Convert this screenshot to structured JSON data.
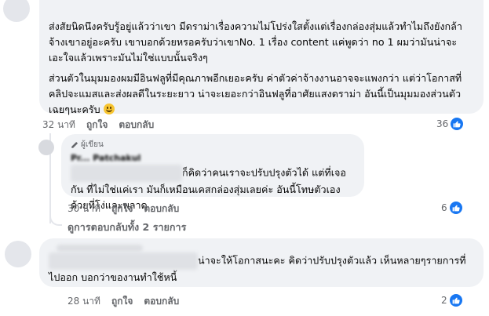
{
  "comment1": {
    "paragraphs": [
      "ส่งสัยนิดนึงครับรู้อยู่แล้วว่าเขา มีดราม่าเรื่องความไม่โปร่งใสตั้งแต่เรื่องกล่องสุ่มแล้วทำไมถึงยังกล้าจ้างเขาอยู่อะครับ เขาบอกด้วยหรอครับว่าเขาNo. 1 เรื่อง content แค่พูดว่า no 1 ผมว่ามันน่าจะเอะใจแล้วเพราะมันไม่ใช่แบบนั้นจริงๆ",
      "ส่วนตัวในมุมมองผมมีอินฟลูที่มีคุณภาพอีกเยอะครับ ค่าตัวค่าจ้างงานอาจจะแพงกว่า แต่ว่าโอกาสที่คลิปจะแมสและส่งผลดีในระยะยาว น่าจะเยอะกว่าอินฟลูที่อาศัยแสงดราม่า อันนี้เป็นมุมมองส่วนตัวเฉยๆนะครับ"
    ],
    "time": "32 นาที",
    "like_label": "ถูกใจ",
    "reply_label": "ตอบกลับ",
    "reactions": "36"
  },
  "reply1": {
    "author_badge": "ผู้เขียน",
    "author_name": "Pr... Patchakul",
    "text": "ก็คิดว่าคนเราจะปรับปรุงตัวได้ แต่ที่เจอกัน ที่ไม่ใช่แค่เรา มันก็เหมือนเคสกล่องสุ่มเลยค่ะ อันนี้โทษตัวเองด้วยที่โง่และพลาด",
    "time": "30 นาที",
    "like_label": "ถูกใจ",
    "reply_label": "ตอบกลับ",
    "reactions": "6"
  },
  "view_replies_label": "ดูการตอบกลับทั้ง 2 รายการ",
  "comment2": {
    "text": "น่าจะให้โอกาสนะคะ คิดว่าปรับปรุงตัวแล้ว เห็นหลายๆรายการที่ไปออก บอกว่าของานทำใช้หนี้",
    "time": "28 นาที",
    "like_label": "ถูกใจ",
    "reply_label": "ตอบกลับ",
    "reactions": "2"
  },
  "colors": {
    "like_blue": "#1877f2",
    "bubble_bg": "#f0f2f5",
    "meta_gray": "#65676b"
  }
}
